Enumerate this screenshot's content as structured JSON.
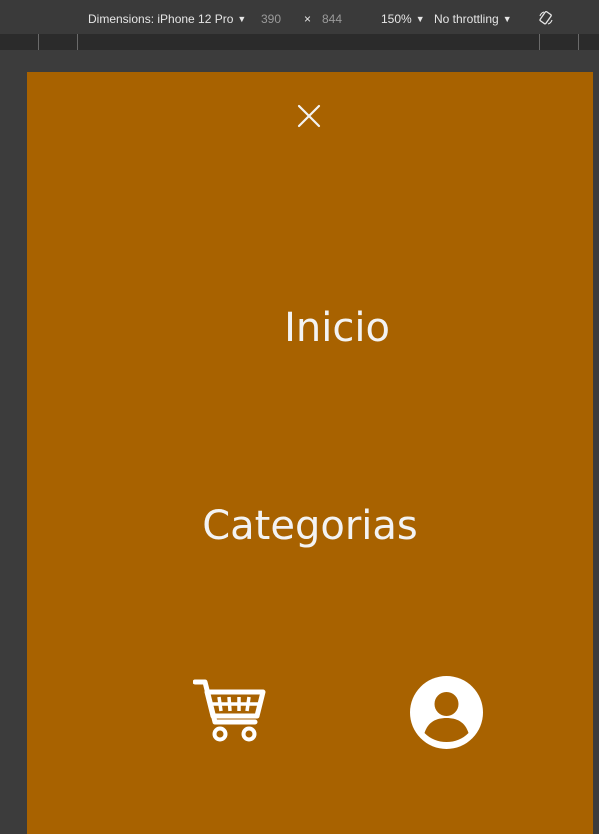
{
  "devtools": {
    "dimensions_label": "Dimensions: iPhone 12 Pro",
    "width_value": "390",
    "times": "×",
    "height_value": "844",
    "zoom_label": "150%",
    "throttling_label": "No throttling"
  },
  "menu": {
    "close_label": "X",
    "items": [
      {
        "label": "Inicio"
      },
      {
        "label": "Categorias"
      }
    ],
    "icons": [
      "cart-icon",
      "user-icon"
    ]
  },
  "colors": {
    "page_background": "#a86200",
    "text": "#f3f3f3",
    "devtools_background": "#3a3a3a"
  }
}
